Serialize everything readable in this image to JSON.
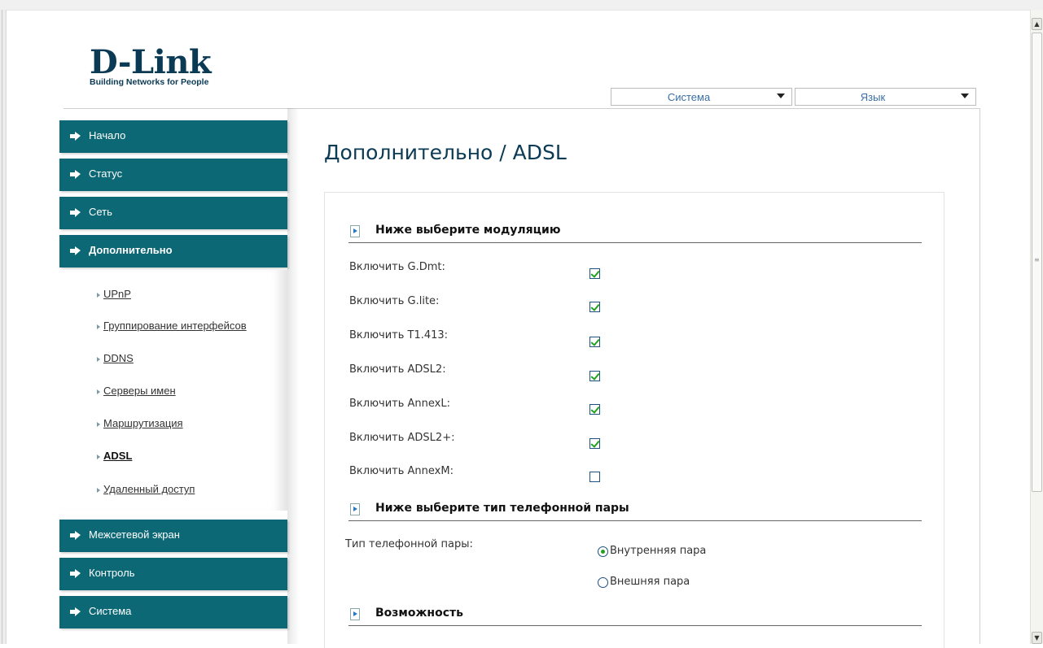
{
  "header": {
    "logo_main": "D-Link",
    "logo_sub": "Building Networks for People",
    "system_select": "Система",
    "language_select": "Язык"
  },
  "sidebar": {
    "items": [
      {
        "label": "Начало"
      },
      {
        "label": "Статус"
      },
      {
        "label": "Сеть"
      },
      {
        "label": "Дополнительно"
      },
      {
        "label": "Межсетевой экран"
      },
      {
        "label": "Контроль"
      },
      {
        "label": "Система"
      }
    ],
    "subitems": [
      {
        "label": "UPnP"
      },
      {
        "label": "Группирование интерфейсов"
      },
      {
        "label": "DDNS"
      },
      {
        "label": "Серверы имен"
      },
      {
        "label": "Маршрутизация"
      },
      {
        "label": "ADSL"
      },
      {
        "label": "Удаленный доступ"
      }
    ]
  },
  "main": {
    "title": "Дополнительно / ADSL",
    "section1": "Ниже выберите модуляцию",
    "options": [
      {
        "label": "Включить G.Dmt:",
        "checked": true
      },
      {
        "label": "Включить G.lite:",
        "checked": true
      },
      {
        "label": "Включить T1.413:",
        "checked": true
      },
      {
        "label": "Включить ADSL2:",
        "checked": true
      },
      {
        "label": "Включить AnnexL:",
        "checked": true
      },
      {
        "label": "Включить ADSL2+:",
        "checked": true
      },
      {
        "label": "Включить AnnexM:",
        "checked": false
      }
    ],
    "section2": "Ниже выберите тип телефонной пары",
    "pair_label": "Тип телефонной пары:",
    "pair_options": [
      {
        "label": "Внутренняя пара",
        "selected": true
      },
      {
        "label": "Внешняя пара",
        "selected": false
      }
    ],
    "section3": "Возможность"
  }
}
